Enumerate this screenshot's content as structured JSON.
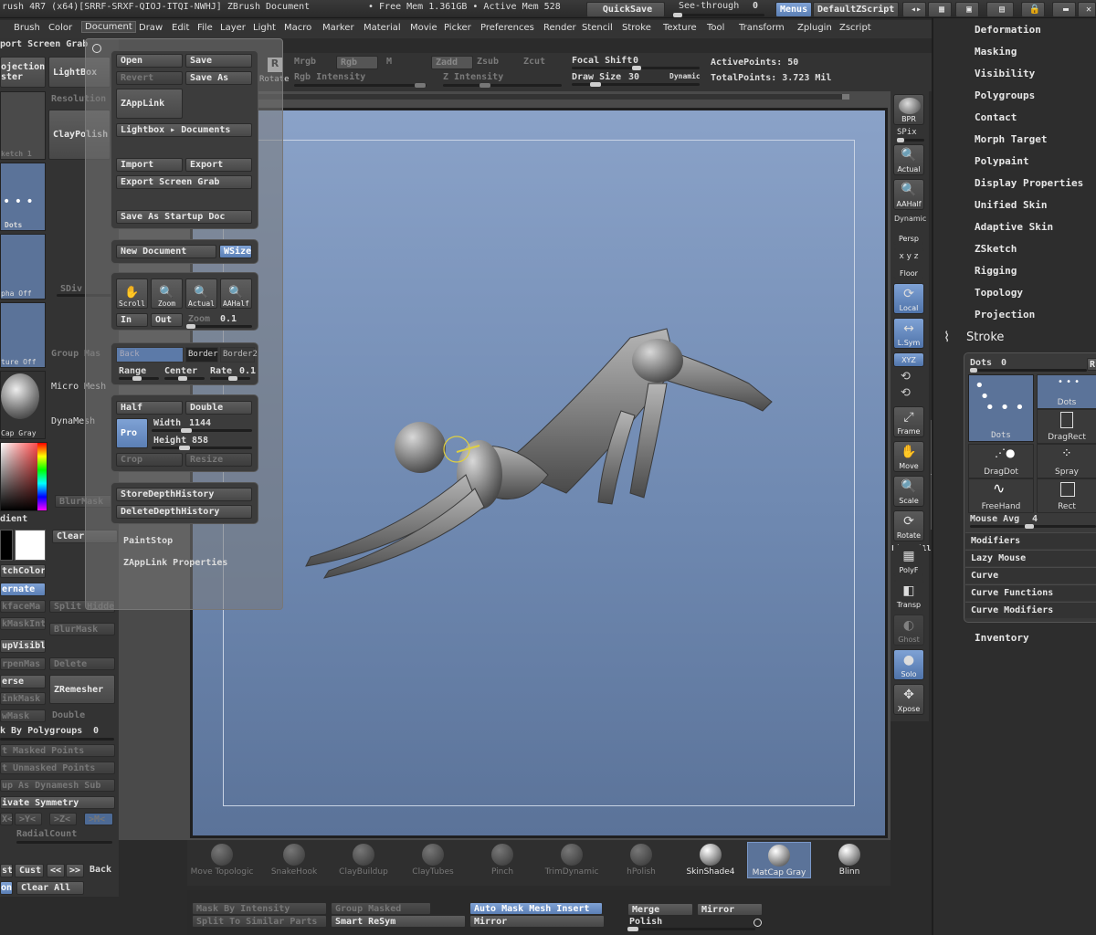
{
  "titlebar": {
    "title": "rush 4R7 (x64)[SRRF-SRXF-QIOJ-ITQI-NWHJ]   ZBrush Document",
    "mem": "• Free Mem 1.361GB • Active Mem 528",
    "quicksave": "QuickSave",
    "seethrough": "See-through",
    "seethrough_val": "0",
    "menus": "Menus",
    "script": "DefaultZScript"
  },
  "menu": [
    "Brush",
    "Color",
    "Document",
    "Draw",
    "Edit",
    "File",
    "Layer",
    "Light",
    "Macro",
    "Marker",
    "Material",
    "Movie",
    "Picker",
    "Preferences",
    "Render",
    "Stencil",
    "Stroke",
    "Texture",
    "Tool",
    "Transform",
    "Zplugin",
    "Zscript"
  ],
  "topbar": {
    "export_grab": "port Screen Grab",
    "projection": "ojection",
    "projection2": "ster",
    "lightbox": "LightBox",
    "rotate": "Rotate",
    "mrgb": "Mrgb",
    "rgb": "Rgb",
    "m": "M",
    "zadd": "Zadd",
    "zsub": "Zsub",
    "zcut": "Zcut",
    "rgb_intensity": "Rgb Intensity",
    "z_intensity": "Z Intensity",
    "focal_shift": "Focal Shift",
    "focal_val": "0",
    "draw_size": "Draw Size",
    "draw_val": "30",
    "dynamic": "Dynamic",
    "active_points": "ActivePoints: 50",
    "total_points": "TotalPoints: 3.723 Mil"
  },
  "document": {
    "open": "Open",
    "save": "Save",
    "revert": "Revert",
    "save_as": "Save As",
    "zapplink": "ZAppLink",
    "lightbox_docs": "Lightbox ▸ Documents",
    "import": "Import",
    "export": "Export",
    "export_grab": "Export Screen Grab",
    "startup": "Save As Startup Doc",
    "new_doc": "New Document",
    "wsize": "WSize",
    "scroll": "Scroll",
    "zoom": "Zoom",
    "actual": "Actual",
    "aahalf": "AAHalf",
    "in": "In",
    "out": "Out",
    "zoom_label": "Zoom",
    "zoom_val": "0.1",
    "back": "Back",
    "border": "Border",
    "border2": "Border2",
    "range": "Range",
    "center": "Center",
    "rate": "Rate",
    "rate_val": "0.1",
    "half": "Half",
    "double": "Double",
    "pro": "Pro",
    "width": "Width",
    "width_val": "1144",
    "height": "Height",
    "height_val": "858",
    "crop": "Crop",
    "resize": "Resize",
    "store_depth": "StoreDepthHistory",
    "delete_depth": "DeleteDepthHistory",
    "paintstop": "PaintStop",
    "zapplink_props": "ZAppLink Properties"
  },
  "leftshelf": {
    "resolution": "Resolution",
    "sketch": "ketch 1",
    "claypolish": "ClayPolish",
    "dots": "Dots",
    "alpha_off": "pha Off",
    "sdiv": "SDiv",
    "texture_off": "ture Off",
    "group_masks": "Group Mas",
    "micro_mesh": "Micro Mesh",
    "dynamesh": "DynaMesh",
    "matcap": "Cap Gray",
    "blurmask": "BlurMask",
    "gradient": "dient",
    "clear": "Clear",
    "switchcolor": "tchColor",
    "alternate": "ernate",
    "backface": "kfaceMa",
    "split_hidden": "Split Hidden",
    "mask_int": "kMaskInt",
    "blurmask2": "BlurMask",
    "group_visible": "upVisible",
    "sharpen": "rpenMas",
    "delete": "Delete",
    "inverse": "erse",
    "zremesher": "ZRemesher",
    "shrink": "inkMask",
    "grow": "wMask",
    "double": "Double",
    "mask_poly": "k By Polygroups",
    "mask_poly_val": "0",
    "masked_pts": "t Masked Points",
    "unmasked_pts": "t Unmasked Points",
    "dynamesh_sub": "up As Dynamesh Sub",
    "activate_sym": "ivate Symmetry",
    "sym_x": "X<",
    "sym_y": ">Y<",
    "sym_z": ">Z<",
    "sym_m": ">M<",
    "radialcount": "RadialCount",
    "st": "st",
    "cust": "Cust",
    "back": "Back",
    "ont": "ont",
    "clear_all": "Clear All"
  },
  "righttools": {
    "bpr": "BPR",
    "spix": "SPix",
    "actual": "Actual",
    "aahalf": "AAHalf",
    "dynamic": "Dynamic",
    "persp": "Persp",
    "floor": "Floor",
    "local": "Local",
    "lsym": "L.Sym",
    "xyz": "XYZ",
    "frame": "Frame",
    "move": "Move",
    "scale": "Scale",
    "rotate": "Rotate",
    "linefill": "Line Fill",
    "polyf": "PolyF",
    "transp": "Transp",
    "ghost": "Ghost",
    "solo": "Solo",
    "xpose": "Xpose"
  },
  "tray": {
    "items": [
      "Deformation",
      "Masking",
      "Visibility",
      "Polygroups",
      "Contact",
      "Morph Target",
      "Polypaint",
      "Display Properties",
      "Unified Skin",
      "Adaptive Skin",
      "ZSketch",
      "Rigging",
      "Topology",
      "Projection"
    ],
    "stroke": "Stroke",
    "dots_label": "Dots",
    "dots_val": "0",
    "dots": "Dots",
    "dots2": "Dots",
    "dragrect": "DragRect",
    "dragdot": "DragDot",
    "spray": "Spray",
    "freehand": "FreeHand",
    "rect": "Rect",
    "mouse_avg": "Mouse Avg",
    "mouse_avg_val": "4",
    "sub": [
      "Modifiers",
      "Lazy Mouse",
      "Curve",
      "Curve Functions",
      "Curve Modifiers"
    ],
    "inventory": "Inventory"
  },
  "bottom": {
    "materials": [
      "Move Topologic",
      "SnakeHook",
      "ClayBuildup",
      "ClayTubes",
      "Pinch",
      "TrimDynamic",
      "hPolish",
      "SkinShade4",
      "MatCap Gray",
      "Blinn"
    ],
    "mask_intensity": "Mask By Intensity",
    "group_masked": "Group Masked",
    "auto_mask": "Auto Mask Mesh Insert",
    "split_similar": "Split To Similar Parts",
    "smart_resym": "Smart ReSym",
    "mirror": "Mirror",
    "merge": "Merge",
    "mirror2": "Mirror",
    "polish": "Polish"
  }
}
